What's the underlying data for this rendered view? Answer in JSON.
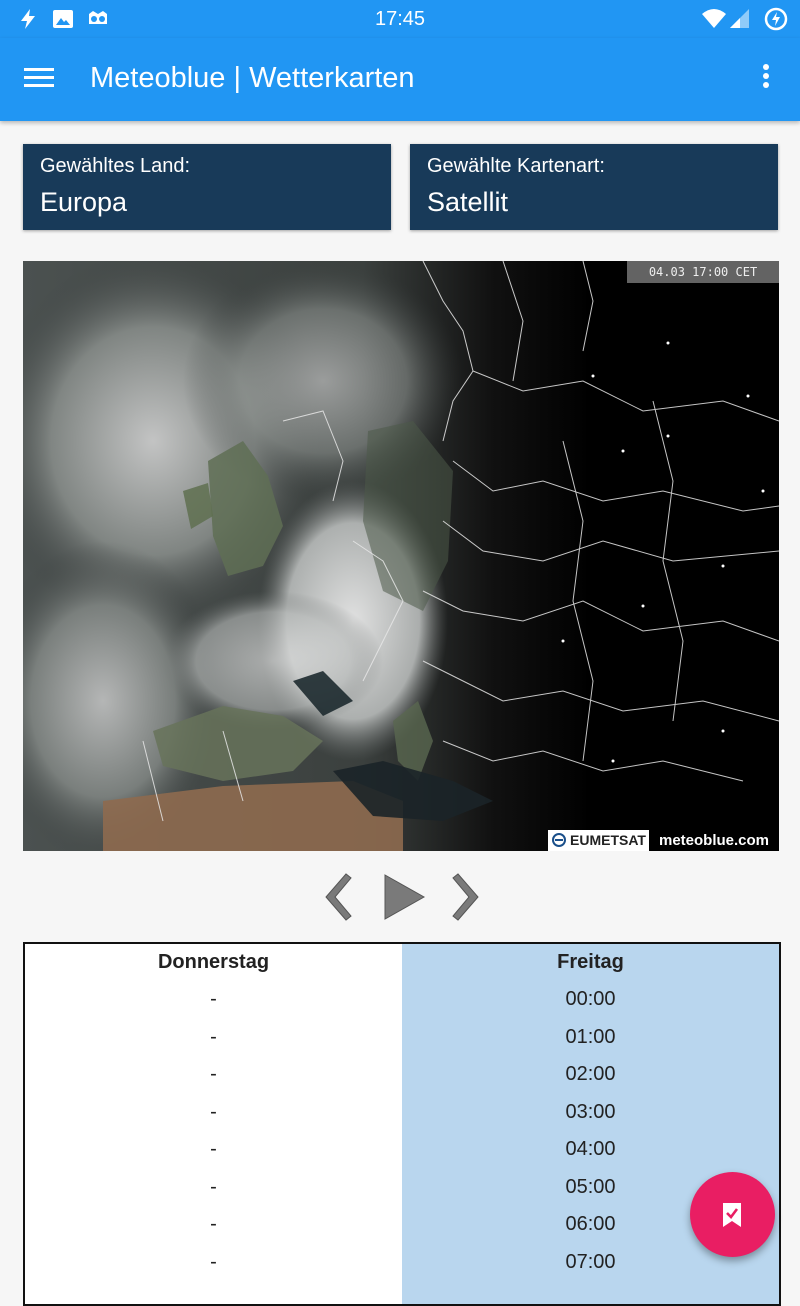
{
  "status_bar": {
    "time": "17:45",
    "icons_left": [
      "flash-icon",
      "image-icon",
      "owl-icon"
    ],
    "icons_right": [
      "wifi-icon",
      "signal-icon",
      "battery-charging-icon"
    ]
  },
  "app_bar": {
    "title": "Meteoblue | Wetterkarten",
    "menu_icon": "hamburger-menu-icon",
    "overflow_icon": "more-vert-icon"
  },
  "selectors": {
    "country": {
      "label": "Gewähltes Land:",
      "value": "Europa"
    },
    "map_type": {
      "label": "Gewählte Kartenart:",
      "value": "Satellit"
    }
  },
  "map": {
    "timestamp": "04.03  17:00 CET",
    "credit_eumetsat": "EUMETSAT",
    "credit_meteoblue": "meteoblue.com"
  },
  "controls": {
    "prev_icon": "chevron-left-icon",
    "play_icon": "play-icon",
    "next_icon": "chevron-right-icon"
  },
  "schedule": {
    "columns": [
      {
        "header": "Donnerstag",
        "cells": [
          "-",
          "-",
          "-",
          "-",
          "-",
          "-",
          "-",
          "-"
        ]
      },
      {
        "header": "Freitag",
        "cells": [
          "00:00",
          "01:00",
          "02:00",
          "03:00",
          "04:00",
          "05:00",
          "06:00",
          "07:00"
        ]
      }
    ],
    "highlight_color": "#b9d6ee"
  },
  "fab": {
    "icon": "bookmark-check-icon",
    "color": "#e91e63"
  },
  "colors": {
    "primary": "#2196f3",
    "selector_bg": "#183a59"
  }
}
